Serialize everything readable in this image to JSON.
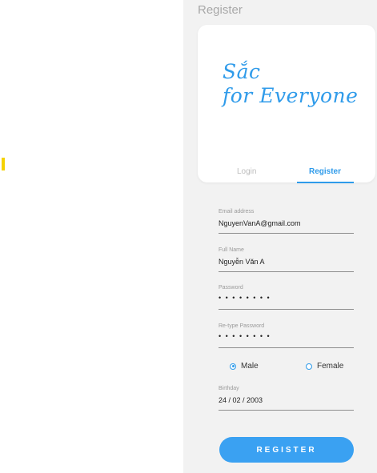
{
  "screen_title": "Register",
  "logo": {
    "line1": "Sắc",
    "line2": "for Everyone"
  },
  "tabs": {
    "login": "Login",
    "register": "Register",
    "active": "register"
  },
  "form": {
    "email": {
      "label": "Email address",
      "value": "NguyenVanA@gmail.com"
    },
    "full_name": {
      "label": "Full Name",
      "value": "Nguyễn Văn A"
    },
    "password": {
      "label": "Password",
      "value": "• • • • • • • •"
    },
    "retype_password": {
      "label": "Re-type Password",
      "value": "• • • • • • • •"
    },
    "gender": {
      "options": [
        "Male",
        "Female"
      ],
      "selected": "Male"
    },
    "birthday": {
      "label": "Birthday",
      "value": "24 / 02 / 2003"
    }
  },
  "register_button": "REGISTER",
  "colors": {
    "accent": "#2f9bea",
    "button": "#3aa1f2",
    "background": "#f2f2f2",
    "marker": "#f5d200"
  }
}
